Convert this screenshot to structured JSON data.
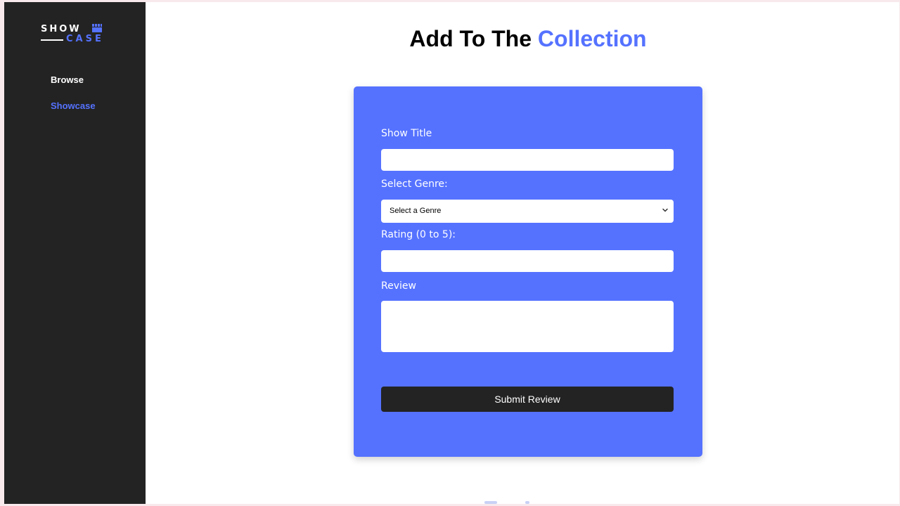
{
  "brand": {
    "logo_top": "SHOW",
    "logo_bottom": "CASE",
    "accent_color": "#5572ff",
    "sidebar_color": "#232323"
  },
  "sidebar": {
    "items": [
      {
        "label": "Browse",
        "active": false
      },
      {
        "label": "Showcase",
        "active": true
      }
    ]
  },
  "header": {
    "title_prefix": "Add To The",
    "title_accent": "Collection"
  },
  "form": {
    "show_title": {
      "label": "Show Title",
      "value": ""
    },
    "genre": {
      "label": "Select Genre:",
      "selected": "Select a Genre"
    },
    "rating": {
      "label": "Rating (0 to 5):",
      "value": ""
    },
    "review": {
      "label": "Review",
      "value": ""
    },
    "submit_label": "Submit Review"
  }
}
